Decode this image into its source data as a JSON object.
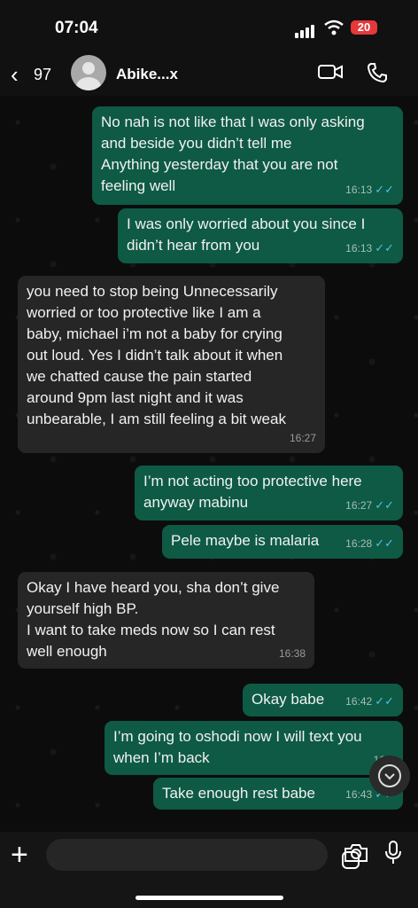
{
  "status": {
    "time": "07:04",
    "battery": "20"
  },
  "header": {
    "back_count": "97",
    "contact_name": "Abike...x"
  },
  "messages": [
    {
      "dir": "out",
      "text": "No nah is not like that I was only asking\nand beside you didn’t tell me\nAnything yesterday that you are not\nfeeling well",
      "time": "16:13"
    },
    {
      "dir": "out",
      "text": "I was only worried about you since I\ndidn’t hear from you",
      "time": "16:13"
    },
    {
      "dir": "in",
      "text": "you need to stop being Unnecessarily\nworried or too protective like I am a\nbaby, michael i’m not a baby for crying\nout loud. Yes I didn’t talk about it when\nwe chatted cause the pain started\naround 9pm last night and it was\nunbearable, I am still feeling a bit weak",
      "time": "16:27"
    },
    {
      "dir": "out",
      "text": "I’m not acting too protective here\nanyway mabinu",
      "time": "16:27"
    },
    {
      "dir": "out",
      "text": "Pele maybe is malaria",
      "time": "16:28"
    },
    {
      "dir": "in",
      "text": "Okay I have heard you, sha don’t give\nyourself high BP.\nI want to take meds now so I can rest\nwell enough",
      "time": "16:38"
    },
    {
      "dir": "out",
      "text": "Okay babe",
      "time": "16:42"
    },
    {
      "dir": "out",
      "text": "I’m going to oshodi now I will text you\nwhen I’m back",
      "time": "16:4"
    },
    {
      "dir": "out",
      "text": "Take enough rest babe",
      "time": "16:43"
    }
  ],
  "icons": {
    "read": "double-check-icon"
  },
  "colors": {
    "outgoing": "#0e5a44",
    "incoming": "#262626",
    "tick": "#53bdeb"
  }
}
